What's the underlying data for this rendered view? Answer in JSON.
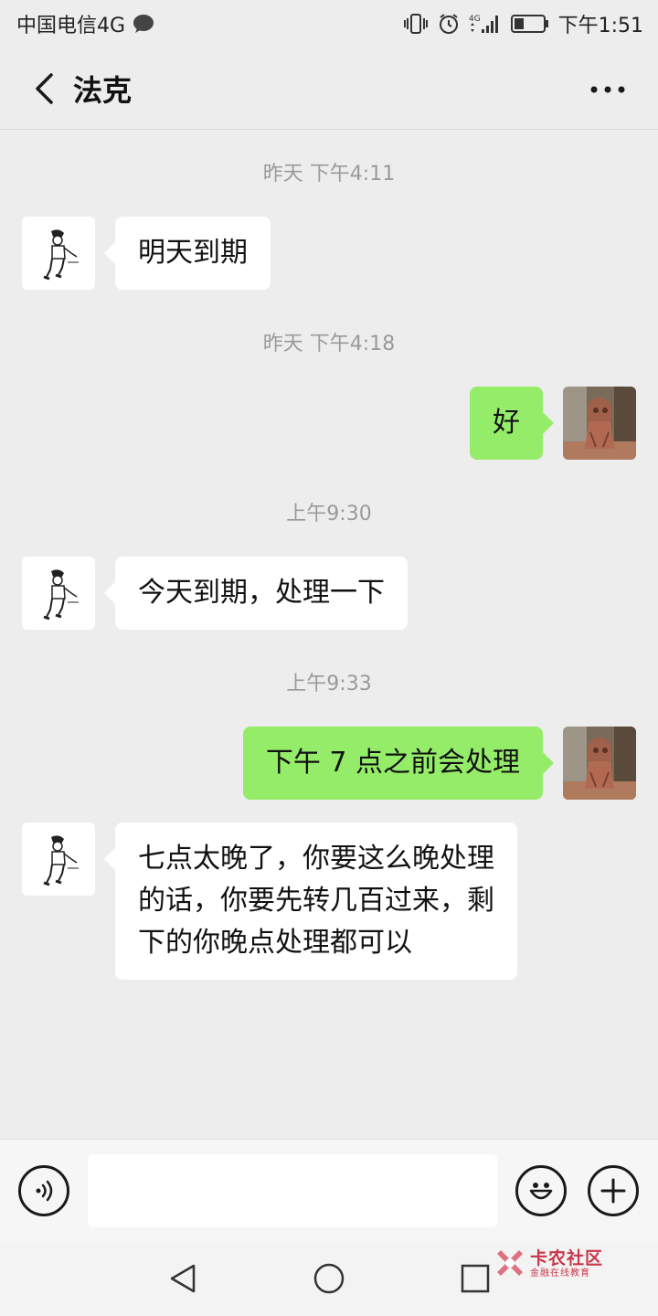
{
  "status_bar": {
    "carrier": "中国电信4G",
    "network_label": "4G",
    "time": "下午1:51"
  },
  "header": {
    "title": "法克"
  },
  "messages": [
    {
      "type": "timestamp",
      "text": "昨天 下午4:11"
    },
    {
      "type": "incoming",
      "text": "明天到期"
    },
    {
      "type": "timestamp",
      "text": "昨天 下午4:18"
    },
    {
      "type": "outgoing",
      "text": "好"
    },
    {
      "type": "timestamp",
      "text": "上午9:30"
    },
    {
      "type": "incoming",
      "text": "今天到期，处理一下"
    },
    {
      "type": "timestamp",
      "text": "上午9:33"
    },
    {
      "type": "outgoing",
      "text": "下午 7 点之前会处理"
    },
    {
      "type": "incoming",
      "lines": [
        "七点太晚了，你要这么晚处理",
        "的话，你要先转几百过来，剩",
        "下的你晚点处理都可以"
      ]
    }
  ],
  "input_bar": {
    "value": "",
    "icons": [
      "voice-icon",
      "emoji-icon",
      "plus-icon"
    ]
  },
  "nav_bar": {
    "icons": [
      "back-triangle-icon",
      "home-circle-icon",
      "recents-square-icon"
    ]
  },
  "watermark": {
    "name": "卡农社区",
    "subtitle": "金融在线教育"
  },
  "colors": {
    "background": "#ededed",
    "incoming_bubble": "#ffffff",
    "outgoing_bubble": "#95ec69",
    "timestamp_text": "#9a9a9a",
    "watermark": "#c9364a"
  }
}
